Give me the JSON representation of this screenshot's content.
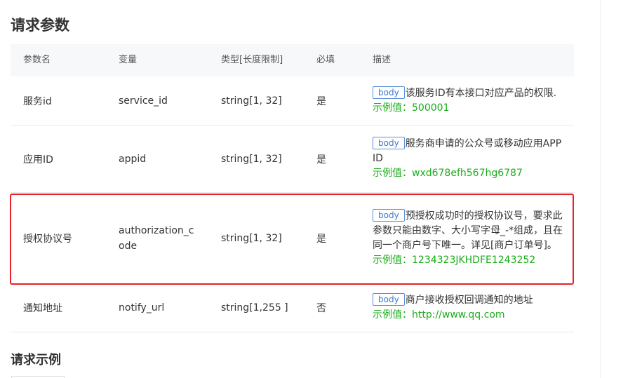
{
  "section_title": "请求参数",
  "columns": {
    "name": "参数名",
    "variable": "变量",
    "type": "类型[长度限制]",
    "required": "必填",
    "description": "描述"
  },
  "rows": [
    {
      "name": "服务id",
      "variable": "service_id",
      "type": "string[1, 32]",
      "required": "是",
      "badge": "body",
      "description": "该服务ID有本接口对应产品的权限.",
      "example": "示例值：500001"
    },
    {
      "name": "应用ID",
      "variable": "appid",
      "type": "string[1, 32]",
      "required": "是",
      "badge": "body",
      "description": "服务商申请的公众号或移动应用APP ID",
      "example": "示例值：wxd678efh567hg6787"
    },
    {
      "name": "授权协议号",
      "variable": "authorization_c ode",
      "type": "string[1, 32]",
      "required": "是",
      "badge": "body",
      "description": "预授权成功时的授权协议号，要求此参数只能由数字、大小写字母_-*组成，且在同一个商户号下唯一。详见[商户订单号]。",
      "example": "示例值：1234323JKHDFE1243252"
    },
    {
      "name": "通知地址",
      "variable": "notify_url",
      "type": "string[1,255 ]",
      "required": "否",
      "badge": "body",
      "description": "商户接收授权回调通知的地址",
      "example": "示例值：http://www.qq.com"
    }
  ],
  "example_title": "请求示例",
  "colors": {
    "highlight_border": "#e5212a",
    "badge": "#3d7bd4",
    "example_text": "#1aad19",
    "header_bg": "#f7f8fa"
  }
}
